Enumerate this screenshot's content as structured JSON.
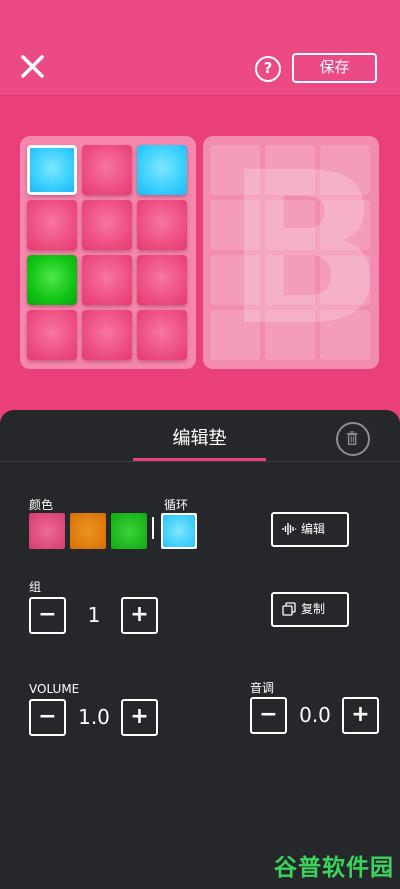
{
  "topbar": {
    "help_label": "?",
    "save_label": "保存"
  },
  "pad_banks": {
    "bank_a": {
      "pads": [
        "cyan-selected",
        "pink",
        "cyan",
        "pink",
        "pink",
        "pink",
        "green",
        "pink",
        "pink",
        "pink",
        "pink",
        "pink"
      ]
    },
    "bank_b": {
      "letter": "B"
    }
  },
  "panel": {
    "title": "编辑垫",
    "color_label": "颜色",
    "loop_label": "循环",
    "colors": [
      "#e4457c",
      "#de7a06",
      "#15b914",
      "#38cfff"
    ],
    "edit_button_label": "编辑",
    "group_label": "组",
    "group_value": "1",
    "copy_button_label": "复制",
    "volume_label": "VOLUME",
    "volume_value": "1.0",
    "pitch_label": "音调",
    "pitch_value": "0.0",
    "minus": "−",
    "plus": "+"
  },
  "watermark": "谷普软件园",
  "colors": {
    "background": "#e9407b",
    "panel": "#25272a",
    "accent": "#e9407b"
  }
}
